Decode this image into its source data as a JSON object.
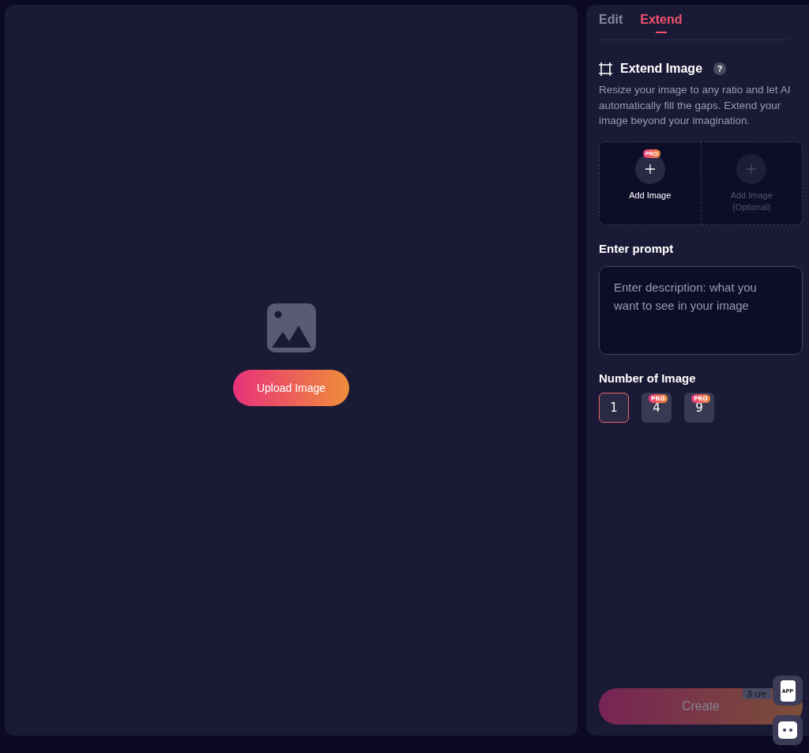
{
  "canvas": {
    "upload_button": "Upload Image"
  },
  "tabs": [
    {
      "label": "Edit",
      "selected": false
    },
    {
      "label": "Extend",
      "selected": true
    }
  ],
  "section": {
    "title": "Extend Image",
    "help": "?",
    "description": "Resize your image to any ratio and let AI automatically fill the gaps. Extend your image beyond your imagination."
  },
  "image_slots": [
    {
      "label": "Add Image",
      "badge": "PRO",
      "disabled": false
    },
    {
      "label": "Add Image\n(Optional)",
      "disabled": true
    }
  ],
  "prompt": {
    "label": "Enter prompt",
    "placeholder": "Enter description: what you want to see in your image"
  },
  "number_of_image": {
    "label": "Number of Image",
    "options": [
      {
        "value": "1",
        "selected": true
      },
      {
        "value": "4",
        "badge": "PRO",
        "selected": false
      },
      {
        "value": "9",
        "badge": "PRO",
        "selected": false
      }
    ]
  },
  "create_button": {
    "label": "Create",
    "disabled": true,
    "credits": "3 cre"
  },
  "floating": {
    "app_label": "APP"
  }
}
